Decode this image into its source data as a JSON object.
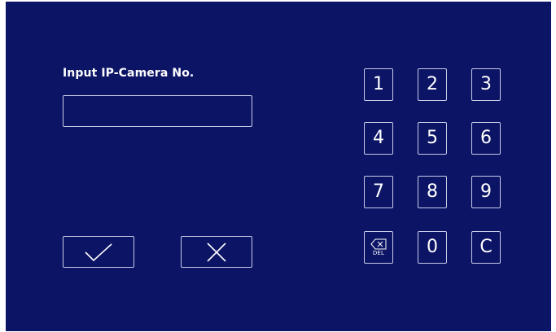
{
  "prompt": {
    "label": "Input IP-Camera No."
  },
  "input": {
    "value": "",
    "placeholder": ""
  },
  "actions": {
    "confirm_icon": "checkmark-icon",
    "cancel_icon": "cross-icon"
  },
  "keypad": {
    "keys": [
      "1",
      "2",
      "3",
      "4",
      "5",
      "6",
      "7",
      "8",
      "9"
    ],
    "delete_label": "DEL",
    "delete_icon": "backspace-icon",
    "zero": "0",
    "clear": "C"
  },
  "colors": {
    "background": "#0c1466",
    "outline": "#c8cce8",
    "text": "#ffffff"
  }
}
